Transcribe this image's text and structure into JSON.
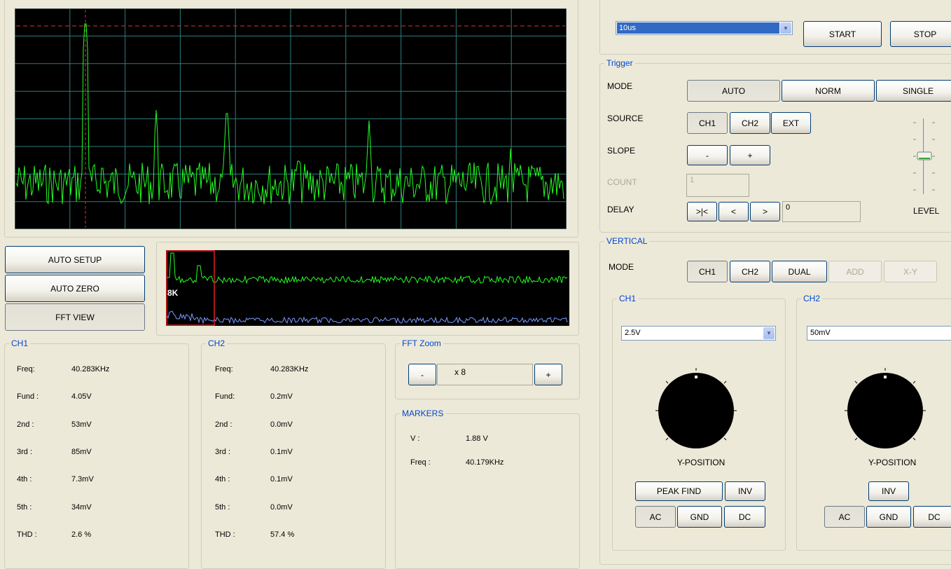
{
  "colors": {
    "trace_ch1": "#00FF00",
    "trace_ch2": "#6699FF",
    "grid": "#2E7D7D",
    "marker": "#FF2020",
    "group_title": "#0046D5"
  },
  "main_buttons": {
    "auto_setup": "AUTO SETUP",
    "auto_zero": "AUTO ZERO",
    "fft_view": "FFT  VIEW"
  },
  "overview": {
    "zoom_badge": "8K"
  },
  "ch1_stats": {
    "title": "CH1",
    "rows": [
      {
        "label": "Freq:",
        "value": "40.283KHz"
      },
      {
        "label": "Fund :",
        "value": "4.05V"
      },
      {
        "label": "2nd :",
        "value": "53mV"
      },
      {
        "label": "3rd :",
        "value": "85mV"
      },
      {
        "label": "4th :",
        "value": "7.3mV"
      },
      {
        "label": "5th :",
        "value": "34mV"
      },
      {
        "label": "THD :",
        "value": "2.6 %"
      }
    ]
  },
  "ch2_stats": {
    "title": "CH2",
    "rows": [
      {
        "label": "Freq:",
        "value": "40.283KHz"
      },
      {
        "label": "Fund:",
        "value": "0.2mV"
      },
      {
        "label": "2nd :",
        "value": "0.0mV"
      },
      {
        "label": "3rd :",
        "value": "0.1mV"
      },
      {
        "label": "4th :",
        "value": "0.1mV"
      },
      {
        "label": "5th :",
        "value": "0.0mV"
      },
      {
        "label": "THD :",
        "value": "57.4 %"
      }
    ]
  },
  "fft_zoom": {
    "title": "FFT Zoom",
    "minus": "-",
    "value": "x 8",
    "plus": "+"
  },
  "markers": {
    "title": "MARKERS",
    "v_label": "V :",
    "v_value": "1.88 V",
    "freq_label": "Freq :",
    "freq_value": "40.179KHz"
  },
  "horizontal": {
    "timebase": "10us",
    "start": "START",
    "stop": "STOP"
  },
  "trigger": {
    "title": "Trigger",
    "mode_label": "MODE",
    "mode_auto": "AUTO",
    "mode_norm": "NORM",
    "mode_single": "SINGLE",
    "source_label": "SOURCE",
    "src_ch1": "CH1",
    "src_ch2": "CH2",
    "src_ext": "EXT",
    "slope_label": "SLOPE",
    "slope_minus": "-",
    "slope_plus": "+",
    "count_label": "COUNT",
    "count_value": "1",
    "delay_label": "DELAY",
    "delay_home": ">|<",
    "delay_left": "<",
    "delay_right": ">",
    "delay_value": "0",
    "level_label": "LEVEL"
  },
  "vertical": {
    "title": "VERTICAL",
    "mode_label": "MODE",
    "mode_ch1": "CH1",
    "mode_ch2": "CH2",
    "mode_dual": "DUAL",
    "mode_add": "ADD",
    "mode_xy": "X-Y",
    "ch1": {
      "title": "CH1",
      "volts": "2.5V",
      "ypos_label": "Y-POSITION",
      "peak_find": "PEAK FIND",
      "inv": "INV",
      "ac": "AC",
      "gnd": "GND",
      "dc": "DC"
    },
    "ch2": {
      "title": "CH2",
      "volts": "50mV",
      "ypos_label": "Y-POSITION",
      "inv": "INV",
      "ac": "AC",
      "gnd": "GND",
      "dc": "DC"
    }
  }
}
